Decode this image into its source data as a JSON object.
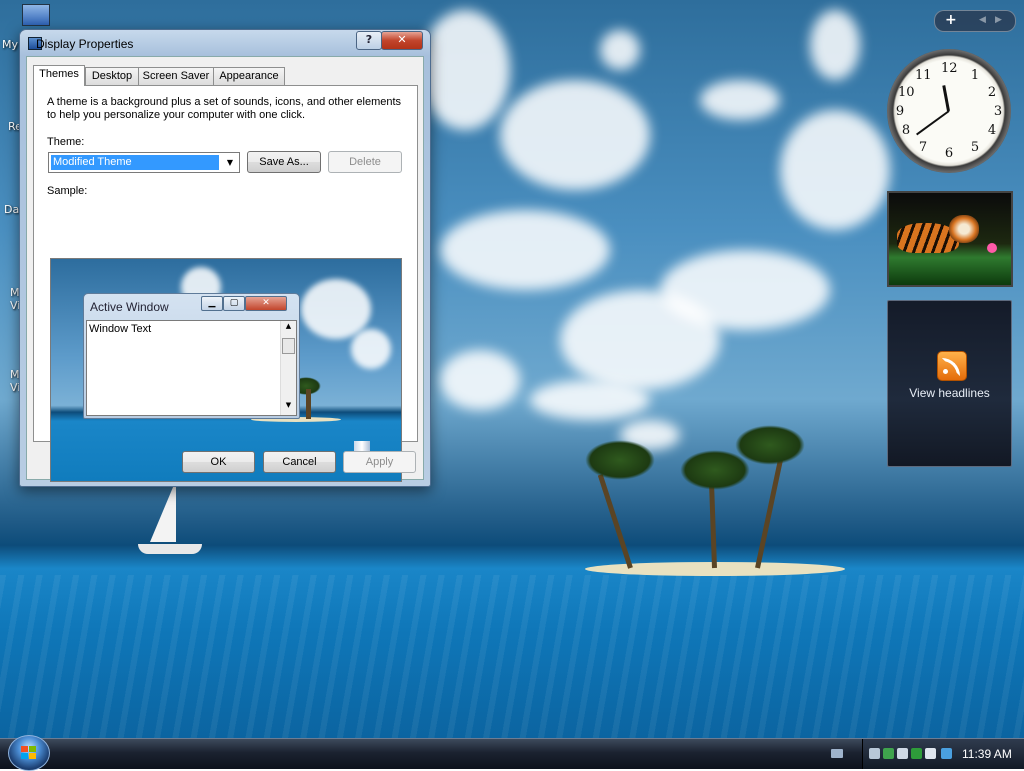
{
  "desktop": {
    "icons": [
      {
        "label": "My C"
      },
      {
        "label": "Rec"
      },
      {
        "label": "Data"
      },
      {
        "label": "M Vis"
      },
      {
        "label": "M Vis"
      }
    ]
  },
  "dialog": {
    "title": "Display Properties",
    "help_glyph": "?",
    "close_glyph": "✕",
    "tabs": [
      {
        "label": "Themes",
        "active": true
      },
      {
        "label": "Desktop",
        "active": false
      },
      {
        "label": "Screen Saver",
        "active": false
      },
      {
        "label": "Appearance",
        "active": false
      }
    ],
    "description": "A theme is a background plus a set of sounds, icons, and other elements to help you personalize your computer with one click.",
    "theme_label": "Theme:",
    "theme_value": "Modified Theme",
    "save_as_label": "Save As...",
    "delete_label": "Delete",
    "sample_label": "Sample:",
    "sample": {
      "window_title": "Active Window",
      "window_text": "Window Text"
    },
    "ok_label": "OK",
    "cancel_label": "Cancel",
    "apply_label": "Apply"
  },
  "sidebar": {
    "add_glyph": "+",
    "clock": {
      "hour": 11,
      "minute": 39,
      "numbers": [
        "12",
        "1",
        "2",
        "3",
        "4",
        "5",
        "6",
        "7",
        "8",
        "9",
        "10",
        "11"
      ]
    },
    "feed": {
      "label": "View headlines"
    }
  },
  "taskbar": {
    "time": "11:39 AM"
  },
  "colors": {
    "selection": "#3399ff",
    "close_button": "#c2452c",
    "rss_orange": "#f08a1c"
  }
}
